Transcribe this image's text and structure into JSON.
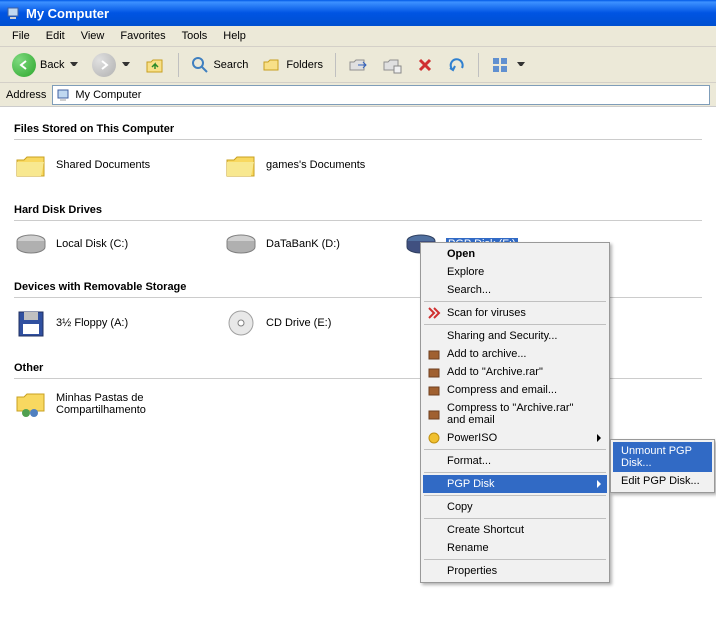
{
  "window": {
    "title": "My Computer"
  },
  "menu": {
    "file": "File",
    "edit": "Edit",
    "view": "View",
    "favorites": "Favorites",
    "tools": "Tools",
    "help": "Help"
  },
  "toolbar": {
    "back": "Back",
    "search": "Search",
    "folders": "Folders"
  },
  "address": {
    "label": "Address",
    "value": "My Computer"
  },
  "sections": {
    "files": {
      "header": "Files Stored on This Computer",
      "items": {
        "shared": "Shared Documents",
        "games": "games's Documents"
      }
    },
    "hdd": {
      "header": "Hard Disk Drives",
      "items": {
        "c": "Local Disk (C:)",
        "d": "DaTaBanK (D:)",
        "pgp": "PGP Disk (F:)"
      }
    },
    "removable": {
      "header": "Devices with Removable Storage",
      "items": {
        "floppy": "3½ Floppy (A:)",
        "cd": "CD Drive (E:)"
      }
    },
    "other": {
      "header": "Other",
      "items": {
        "minhas": "Minhas Pastas de Compartilhamento"
      }
    }
  },
  "context": {
    "open": "Open",
    "explore": "Explore",
    "search": "Search...",
    "scan": "Scan for viruses",
    "sharing": "Sharing and Security...",
    "addarchive": "Add to archive...",
    "addto": "Add to \"Archive.rar\"",
    "compressemail": "Compress and email...",
    "compressto": "Compress to \"Archive.rar\" and email",
    "poweriso": "PowerISO",
    "format": "Format...",
    "pgpdisk": "PGP Disk",
    "copy": "Copy",
    "createshortcut": "Create Shortcut",
    "rename": "Rename",
    "properties": "Properties"
  },
  "submenu": {
    "unmount": "Unmount PGP Disk...",
    "edit": "Edit PGP Disk..."
  }
}
